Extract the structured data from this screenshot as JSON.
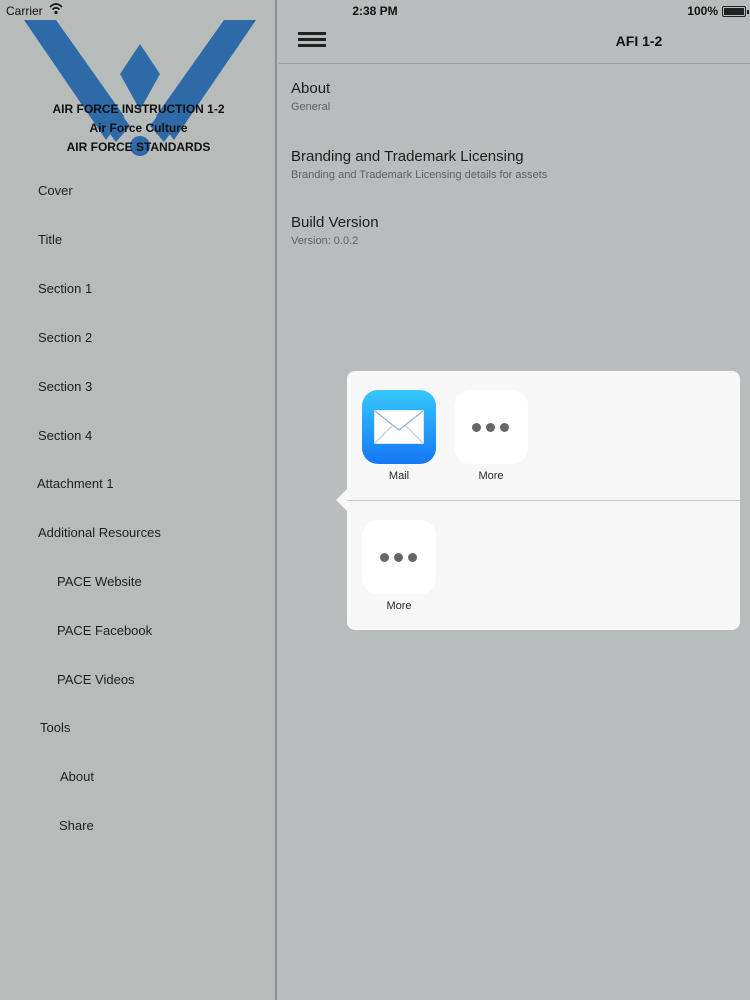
{
  "status": {
    "carrier": "Carrier",
    "time": "2:38 PM",
    "battery": "100%"
  },
  "sidebar": {
    "logo": {
      "title": "AIR FORCE INSTRUCTION 1-2",
      "subtitle": "Air Force Culture",
      "standards": "AIR FORCE STANDARDS"
    },
    "items": [
      {
        "label": "Cover"
      },
      {
        "label": "Title"
      },
      {
        "label": "Section 1"
      },
      {
        "label": "Section 2"
      },
      {
        "label": "Section 3"
      },
      {
        "label": "Section 4"
      },
      {
        "label": "Attachment 1"
      },
      {
        "label": "Additional Resources"
      },
      {
        "label": "PACE Website"
      },
      {
        "label": "PACE Facebook"
      },
      {
        "label": "PACE Videos"
      },
      {
        "label": "Tools"
      },
      {
        "label": "About"
      },
      {
        "label": "Share"
      }
    ]
  },
  "header": {
    "title": "AFI 1-2"
  },
  "content": {
    "items": [
      {
        "title": "About",
        "subtitle": "General"
      },
      {
        "title": "Branding and Trademark Licensing",
        "subtitle": "Branding and Trademark Licensing details for assets"
      },
      {
        "title": "Build Version",
        "subtitle": "Version: 0.0.2"
      }
    ]
  },
  "share_sheet": {
    "row1": [
      {
        "label": "Mail",
        "icon": "mail-icon"
      },
      {
        "label": "More",
        "icon": "more-icon"
      }
    ],
    "row2": [
      {
        "label": "More",
        "icon": "more-icon"
      }
    ]
  }
}
